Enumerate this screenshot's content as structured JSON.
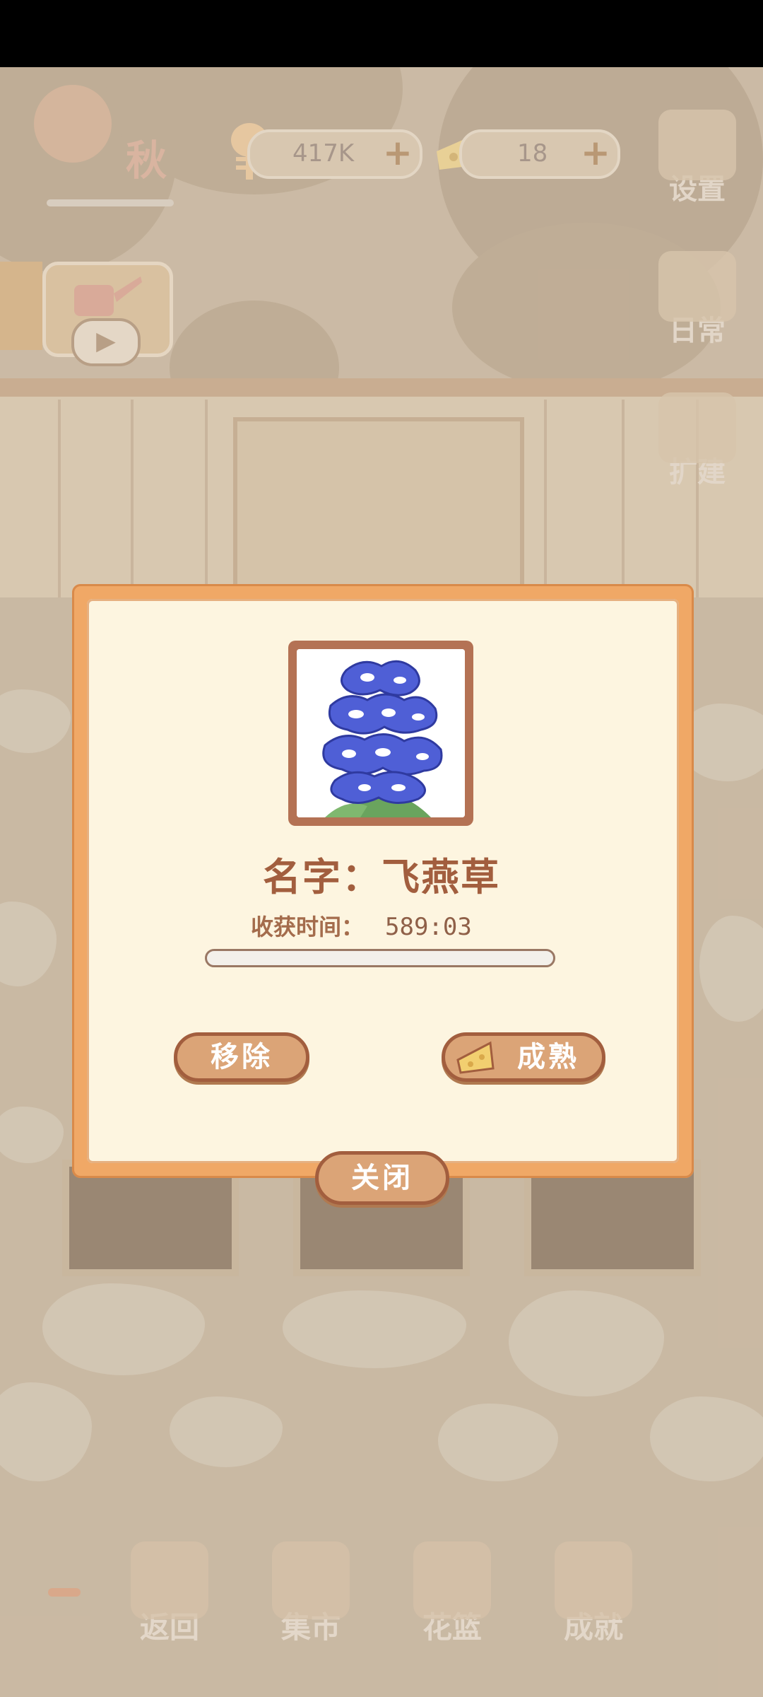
{
  "hud": {
    "season": "秋",
    "fish_bones": "417K",
    "cheese": "18"
  },
  "side_menu": {
    "settings": "设置",
    "daily": "日常",
    "expand": "扩建"
  },
  "bottom_nav": {
    "back": "返回",
    "market": "集市",
    "flower_basket": "花篮",
    "achievement": "成就"
  },
  "dialog": {
    "name_label": "名字：",
    "flower_name": "飞燕草",
    "harvest_label": "收获时间：",
    "harvest_time": "589:03",
    "progress_fraction": 0.0,
    "remove_button": "移除",
    "mature_button": "成熟",
    "close_button": "关闭"
  },
  "colors": {
    "dialog_border": "#f0a866",
    "dialog_bg": "#fdf5e0",
    "text_brown": "#a25e3e",
    "button_fill": "#dba477",
    "flower_blue": "#4f5fd6"
  }
}
